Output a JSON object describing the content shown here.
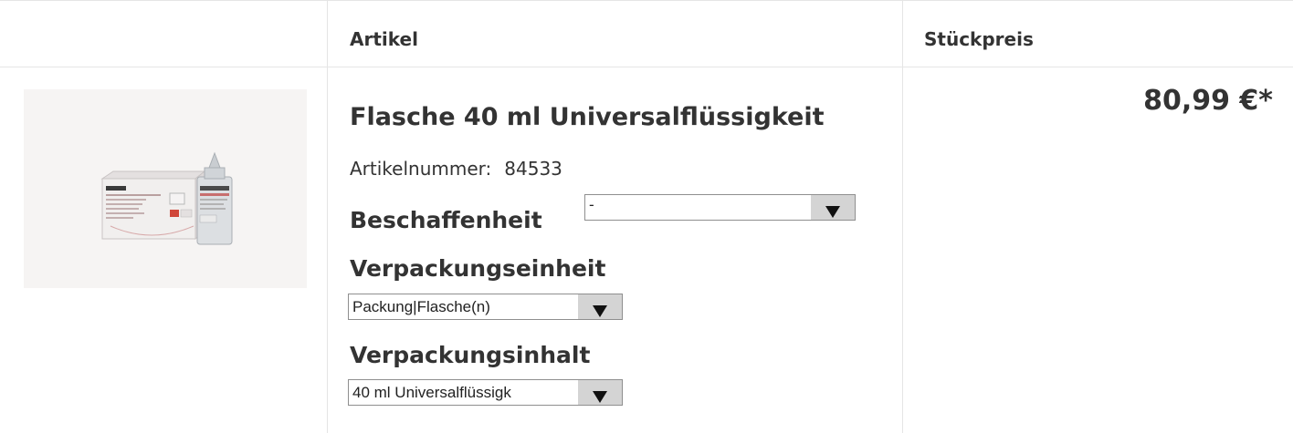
{
  "header": {
    "article_label": "Artikel",
    "unit_price_label": "Stückpreis"
  },
  "product": {
    "image_icon": "product-image-bottle-box",
    "title": "Flasche 40 ml Universalflüssigkeit",
    "article_number_label": "Artikelnummer:",
    "article_number": "84533",
    "price": "80,99 €*",
    "options": {
      "beschaffenheit_label": "Beschaffenheit",
      "beschaffenheit_value": "-",
      "verpackungseinheit_label": "Verpackungseinheit",
      "verpackungseinheit_value": "Packung|Flasche(n)",
      "verpackungsinhalt_label": "Verpackungsinhalt",
      "verpackungsinhalt_value": "40 ml Universalflüssigk"
    }
  }
}
